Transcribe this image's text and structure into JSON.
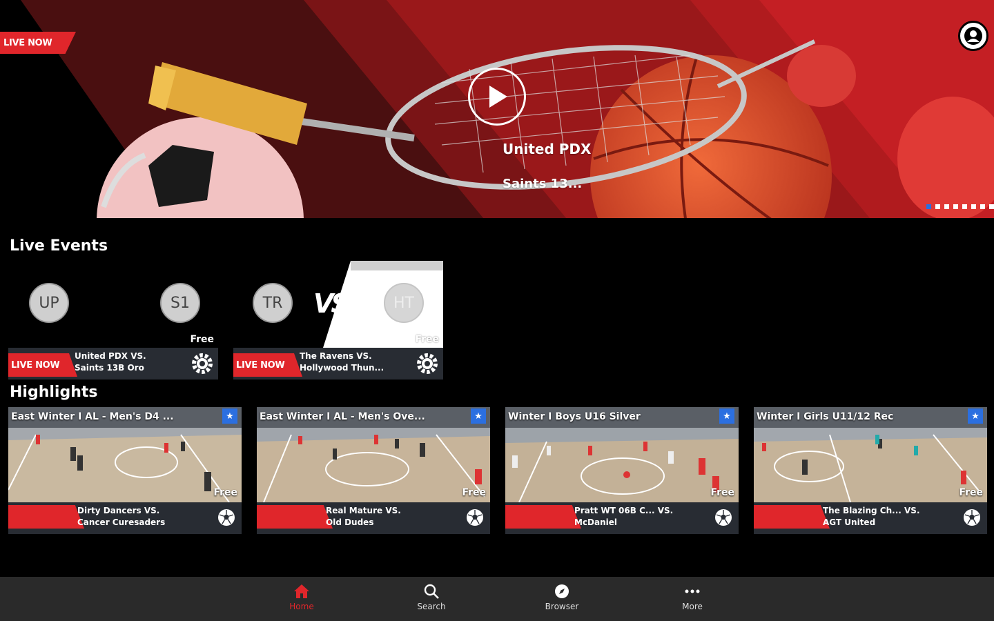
{
  "hero": {
    "live_label": "LIVE NOW",
    "title": "United PDX",
    "subtitle": "Saints 13...",
    "slide_count": 9,
    "active_slide": 0
  },
  "sections": {
    "live_events": "Live Events",
    "highlights": "Highlights"
  },
  "live_events": [
    {
      "team1": "UP",
      "team2": "S1",
      "price": "Free",
      "live_label": "LIVE NOW",
      "line1": "United PDX VS.",
      "line2": "Saints 13B Oro"
    },
    {
      "team1": "TR",
      "team2": "HT",
      "price": "Free",
      "live_label": "LIVE NOW",
      "line1": "The Ravens VS.",
      "line2": "Hollywood Thun..."
    }
  ],
  "highlights": [
    {
      "title": "East Winter I AL - Men's D4 ...",
      "price": "Free",
      "line1": "Dirty Dancers VS.",
      "line2": "Cancer Curesaders"
    },
    {
      "title": "East Winter I AL - Men's Ove...",
      "price": "Free",
      "line1": "Real Mature VS.",
      "line2": "Old Dudes"
    },
    {
      "title": "Winter I Boys U16 Silver",
      "price": "Free",
      "line1": "Pratt WT 06B C... VS.",
      "line2": "McDaniel"
    },
    {
      "title": "Winter I Girls U11/12 Rec",
      "price": "Free",
      "line1": "The Blazing Ch... VS.",
      "line2": "AGT United"
    }
  ],
  "nav": {
    "home": "Home",
    "search": "Search",
    "browser": "Browser",
    "more": "More"
  },
  "colors": {
    "accent": "#e0262b",
    "card_bar": "#282c33",
    "star": "#2b6fe0",
    "nav_bg": "#2a2a2a"
  }
}
